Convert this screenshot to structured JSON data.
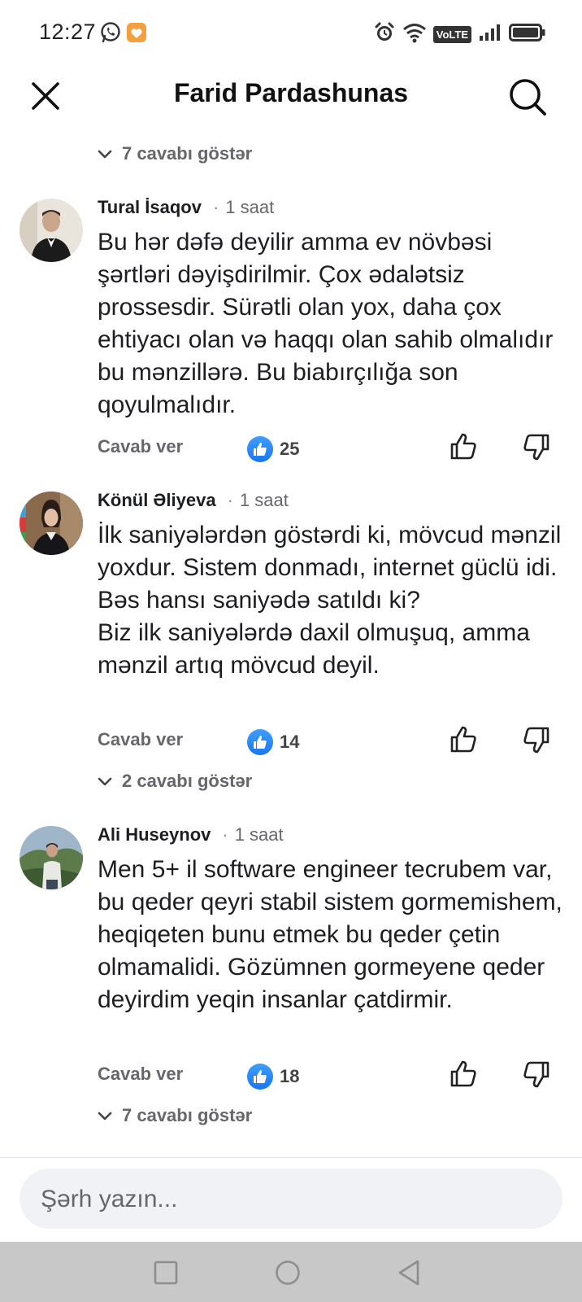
{
  "status_bar": {
    "time": "12:27",
    "left_icons": [
      "whatsapp-icon",
      "app-notification-icon"
    ],
    "right_icons": [
      "alarm-icon",
      "wifi-icon",
      "volte-icon",
      "signal-icon",
      "battery-icon"
    ],
    "volte_label": "VoLTE"
  },
  "header": {
    "title": "Farid Pardashunas"
  },
  "top_replies": {
    "label": "7 cavabı göstər"
  },
  "comments": [
    {
      "author": "Tural İsaqov",
      "time": "1 saat",
      "text": "Bu hər dəfə deyilir amma ev növbəsi şərtləri dəyişdirilmir. Çox ədalətsiz prossesdir. Sürətli olan yox, daha çox ehtiyacı olan və haqqı olan sahib olmalıdır bu mənzillərə. Bu biabırçılığa son qoyulmalıdır.",
      "reply_label": "Cavab ver",
      "likes": "25"
    },
    {
      "author": "Könül Əliyeva",
      "time": "1 saat",
      "text": "İlk saniyələrdən göstərdi ki, mövcud mənzil yoxdur. Sistem donmadı, internet güclü idi. Bəs hansı saniyədə satıldı ki?\nBiz ilk saniyələrdə daxil olmuşuq, amma mənzil artıq mövcud deyil.",
      "reply_label": "Cavab ver",
      "likes": "14",
      "replies_label": "2 cavabı göstər"
    },
    {
      "author": "Ali Huseynov",
      "time": "1 saat",
      "text": "Men 5+ il software engineer tecrubem var, bu qeder qeyri stabil sistem gormemishem, heqiqeten bunu etmek bu qeder çetin olmamalidi. Gözümnen gormeyene qeder deyirdim yeqin insanlar çatdirmir.",
      "reply_label": "Cavab ver",
      "likes": "18",
      "replies_label": "7 cavabı göstər"
    }
  ],
  "composer": {
    "placeholder": "Şərh yazın..."
  },
  "colors": {
    "like_blue": "#1877f2",
    "meta_grey": "#65676b",
    "composer_bg": "#f0f2f5",
    "nav_bg": "#c8c8c8"
  },
  "nav_bar": {
    "buttons": [
      "recent-apps-icon",
      "home-icon",
      "back-icon"
    ]
  }
}
